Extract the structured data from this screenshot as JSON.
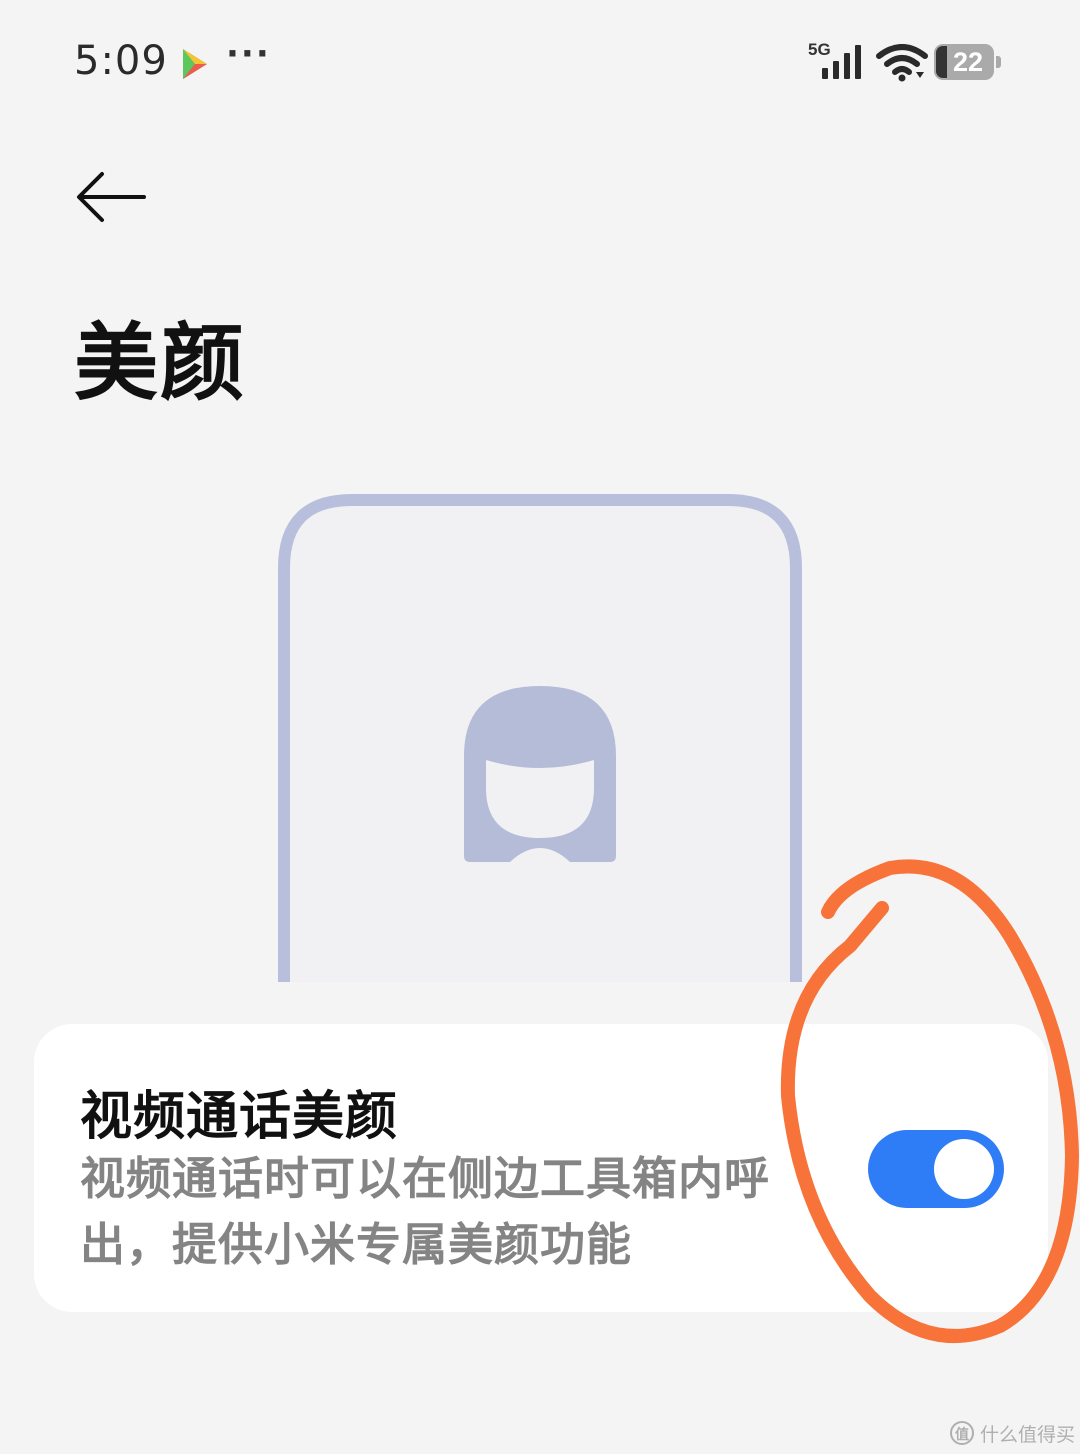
{
  "status_bar": {
    "time": "5:09",
    "more": "···",
    "network": "5G",
    "battery": "22"
  },
  "header": {
    "title": "美颜"
  },
  "setting": {
    "title": "视频通话美颜",
    "description": "视频通话时可以在侧边工具箱内呼出，提供小米专属美颜功能",
    "enabled": true
  },
  "colors": {
    "accent": "#2f7df6",
    "annotation": "#f7733a",
    "illustration": "#b5bcd8"
  },
  "icons": [
    "back-arrow-icon",
    "play-icon",
    "signal-icon",
    "wifi-icon",
    "battery-icon",
    "avatar-icon"
  ],
  "watermark": {
    "logo": "值",
    "text": "什么值得买"
  }
}
